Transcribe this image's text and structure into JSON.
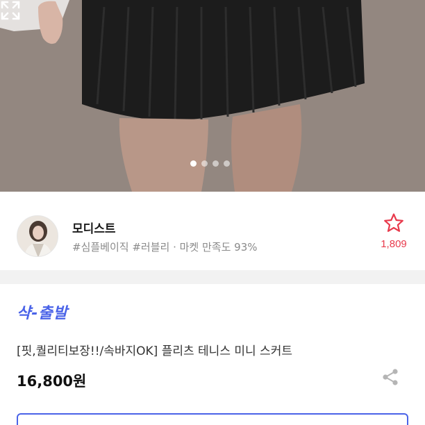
{
  "gallery": {
    "image_description": "model wearing black pleated tennis mini skirt",
    "indicator_count": 4,
    "active_index": 0,
    "expand_icon": "expand-icon"
  },
  "shop": {
    "name": "모디스트",
    "tags": "#심플베이직 #러블리 · 마켓 만족도 93%",
    "favorite_icon": "star-outline-icon",
    "favorite_count": "1,809",
    "accent_color": "#e83a4c"
  },
  "product": {
    "badge": "샥-출발",
    "badge_color": "#4a63e8",
    "title": "[핏,퀄리티보장!!/속바지OK] 플리츠 테니스 미니 스커트",
    "price": "16,800원",
    "share_icon": "share-icon"
  }
}
